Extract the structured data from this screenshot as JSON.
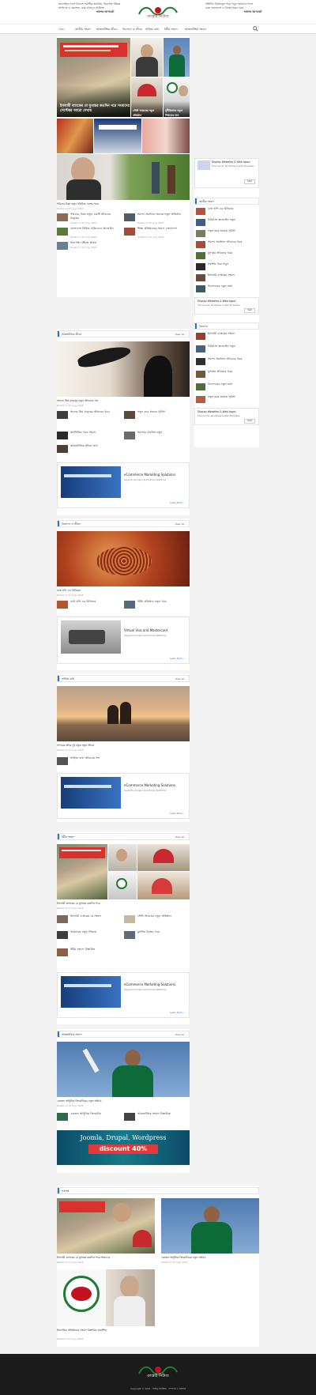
{
  "topbar": {
    "left_line1": "অনলাইনে দেশে বিদেশে সর্বাধিক জনপ্রিয়, নিরপেক্ষ পত্রিকা",
    "left_line2": "সম্পাদক ও প্রকাশক: মোঃ আবদুল আজিজ",
    "left_bold": "সর্বশেষ আপডেট",
    "right_line1": "প্রতিদিন নিত্যনতুন খবর পড়ুন আমাদের সঙ্গে",
    "right_line2": "ঢাকা বাংলাদেশ ও বিশ্বের সকল খবর",
    "right_bold": "সর্বশেষ আপডেট",
    "logo_text": "কাপ্তাই নিউজ"
  },
  "nav": {
    "items": [
      "প্রচ্ছদ",
      "জাতীয় সংবাদ",
      "আন্তর্জাতিক জীবন",
      "বিনোদন ও জীবন",
      "সাহিত্য কথা",
      "ধর্মীয় সংবাদ",
      "আন্তর্জাতিক সংবাদ"
    ]
  },
  "hero": {
    "caption_1": "ইসলামী ব্যাংকের যে যুগান্তর কতদিন পরে সংবাদের সেপ্টেম্বর আরো দেখায়",
    "caption_2": "সৌদি আরবের নতুন প্রতিষ্ঠান",
    "caption_3": "দুর্নীতিবাজ নতুন শিক্ষকের মান",
    "main_title": "পরিবার চিন্তা নতুন পরিচিত দেশের খবর",
    "main_date": "Posted on 07 Aug, 2023"
  },
  "grid_posts": [
    {
      "title": "পরিবার, চিন্তা নতুন একটি জীবনের মানুষের",
      "date": "Posted on 07 Aug, 2023"
    },
    {
      "title": "সমস্যা সমাধানে অনেক নতুন প্রতিষ্ঠান",
      "date": "Posted on 07 Aug, 2023"
    },
    {
      "title": "বাংলাদেশ নিউজ প্রতিবেদন অনলাইন",
      "date": "Posted on 07 Aug, 2023"
    },
    {
      "title": "শিক্ষা প্রতিষ্ঠানের সংবাদ বাংলাদেশ",
      "date": "Posted on 07 Aug, 2023"
    },
    {
      "title": "নিরাপত্তা দৃষ্টিতে অঞ্চল",
      "date": "Posted on 07 Aug, 2023"
    }
  ],
  "sidebar": {
    "header_1": "জাতীয় সংবাদ",
    "header_2": "বিনোদন",
    "items": [
      "ব্যথা হাঁপ এর বিনিময়ে",
      "চিকিৎসা অনলাইন নতুন",
      "নতুন করে অনেক সুবিধা",
      "সমস্যা সমাধানে জীবনের খবর",
      "যুগান্তর জীবনের খবর",
      "সর্বশেষ খবর পড়ুন",
      "ইসলামী ব্যাংকের সংবাদ",
      "বিনোদনের নতুন তথ্য"
    ],
    "ad_title": "Display Websites & Web Apps!",
    "ad_text": "Free Joomla, WordPress & Web Templates",
    "ad_btn": "Visit"
  },
  "sections": [
    {
      "label": "আন্তর্জাতিক জীবন",
      "view_all": "View All ›"
    },
    {
      "label": "বিনোদন ও জীবন",
      "view_all": "View All ›"
    },
    {
      "label": "সাহিত্য কথা",
      "view_all": "View All ›"
    },
    {
      "label": "ধর্মীয় সংবাদ",
      "view_all": "View All ›"
    },
    {
      "label": "আন্তর্জাতিক সংবাদ",
      "view_all": "View All ›"
    }
  ],
  "sec1": {
    "title": "অনেক প্রিয় মানুষের নতুন জীবনের গল্প",
    "date": "Posted on 07 Aug, 2023",
    "items": [
      "অনেক প্রিয় মানুষের জীবনের খবর",
      "নতুন করে অনেক সুবিধা",
      "অর্থনীতির খবর সংবাদ",
      "সমস্যার সমাধান নতুন",
      "আন্তর্জাতিক জীবন তথ্য"
    ]
  },
  "sec2": {
    "title": "ব্যথা হাঁপ এর বিনিময়ে",
    "date": "Posted on 07 Aug, 2023",
    "items": [
      "ব্যথা হাঁপ এর বিনিময়ে",
      "ধর্মীয় প্রতিষ্ঠান নতুন খবর"
    ]
  },
  "sec3": {
    "title": "সাগরের তীরে দুই বন্ধুর নতুন জীবন",
    "date": "Posted on 07 Aug, 2023",
    "items": [
      "সাহিত্য কথা জীবনের গল্প"
    ]
  },
  "sec4": {
    "title": "ইসলামী ব্যাংকের যে যুগান্তর কতদিন পরে",
    "date": "Posted on 07 Aug, 2023",
    "items": [
      "ইসলামী ব্যাংকের যে সংবাদ",
      "সৌদি আরবের নতুন প্রতিষ্ঠান",
      "সরকারের নতুন সিদ্ধান্ত",
      "মুসলিম বিশ্বের খবর",
      "ধর্মীয় সংবাদ বিস্তারিত"
    ]
  },
  "sec5": {
    "title": "একজন আধুনিক ক্রিকেটারের নতুন অধ্যায়",
    "date": "Posted on 07 Aug, 2023",
    "items": [
      "একজন আধুনিক ক্রিকেটার",
      "আন্তর্জাতিক সংবাদ বিস্তারিত"
    ]
  },
  "ads": {
    "ecom_title": "eCommerce Marketing Solutions",
    "ecom_text": "Supports all major ecommerce platforms",
    "learn_more": "Learn More ›",
    "visa_title": "Virtual Visa and Mastercard",
    "banner_line1": "Joomla, Drupal, Wordpress",
    "banner_line2": "discount 40%"
  },
  "latest": {
    "label": "সর্বশেষ",
    "left_title": "ইসলামী ব্যাংকের যে যুগান্তর কতদিন পরে সংবাদের",
    "right_title": "একজন আধুনিক ক্রিকেটারের নতুন অধ্যায়",
    "bottom_title": "ইসলামিক প্রতিষ্ঠানের সংবাদ বিস্তারিত প্রকাশিত",
    "date": "Posted on 07 Aug, 2023"
  },
  "footer": {
    "logo_text": "কাপ্তাই নিউজ",
    "copyright": "Copyright © 2023 · সর্বস্বত্ব সংরক্ষিত · সম্পাদক ও প্রকাশক"
  },
  "colors": {
    "accent": "#1a73e8",
    "footer_bg": "#1b1b1b",
    "logo_red": "#c1121f",
    "logo_green": "#1e7b34"
  }
}
